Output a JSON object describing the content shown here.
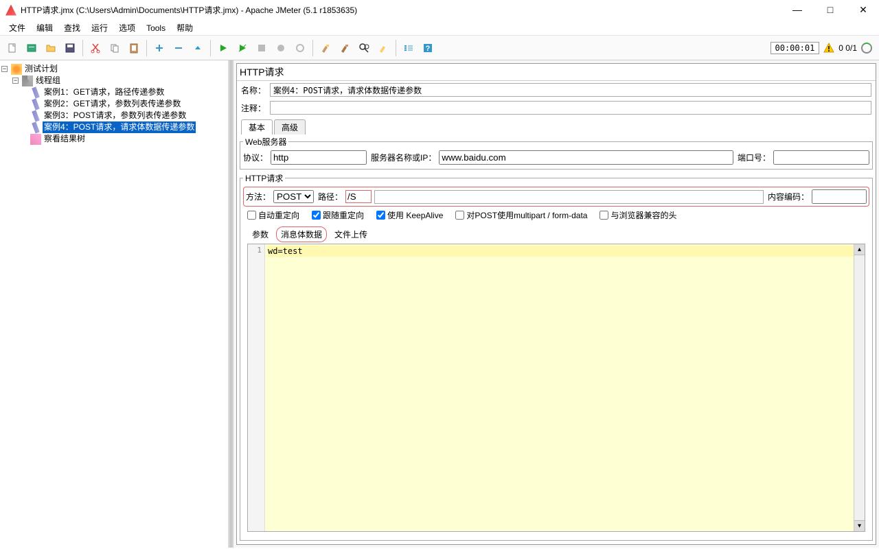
{
  "window": {
    "title": "HTTP请求.jmx (C:\\Users\\Admin\\Documents\\HTTP请求.jmx) - Apache JMeter (5.1 r1853635)"
  },
  "menu": [
    "文件",
    "编辑",
    "查找",
    "运行",
    "选项",
    "Tools",
    "帮助"
  ],
  "status": {
    "timer": "00:00:01",
    "count": "0  0/1"
  },
  "tree": {
    "root": "测试计划",
    "group": "线程组",
    "items": [
      "案例1：GET请求，路径传递参数",
      "案例2：GET请求，参数列表传递参数",
      "案例3：POST请求，参数列表传递参数",
      "案例4：POST请求，请求体数据传递参数"
    ],
    "listener": "察看结果树"
  },
  "panel": {
    "title": "HTTP请求",
    "name_label": "名称：",
    "name_value": "案例4：POST请求，请求体数据传递参数",
    "comment_label": "注释："
  },
  "tabs": {
    "basic": "基本",
    "advanced": "高级"
  },
  "webserver": {
    "legend": "Web服务器",
    "protocol_label": "协议：",
    "protocol": "http",
    "server_label": "服务器名称或IP：",
    "server": "www.baidu.com",
    "port_label": "端口号："
  },
  "http": {
    "legend": "HTTP请求",
    "method_label": "方法：",
    "method": "POST",
    "path_label": "路径：",
    "path": "/S",
    "encoding_label": "内容编码："
  },
  "checks": {
    "auto": "自动重定向",
    "follow": "跟随重定向",
    "keepalive": "使用 KeepAlive",
    "multipart": "对POST使用multipart / form-data",
    "browser": "与浏览器兼容的头"
  },
  "data_tabs": {
    "params": "参数",
    "body": "消息体数据",
    "files": "文件上传"
  },
  "body": {
    "line1": "wd=test",
    "lineno": "1"
  }
}
